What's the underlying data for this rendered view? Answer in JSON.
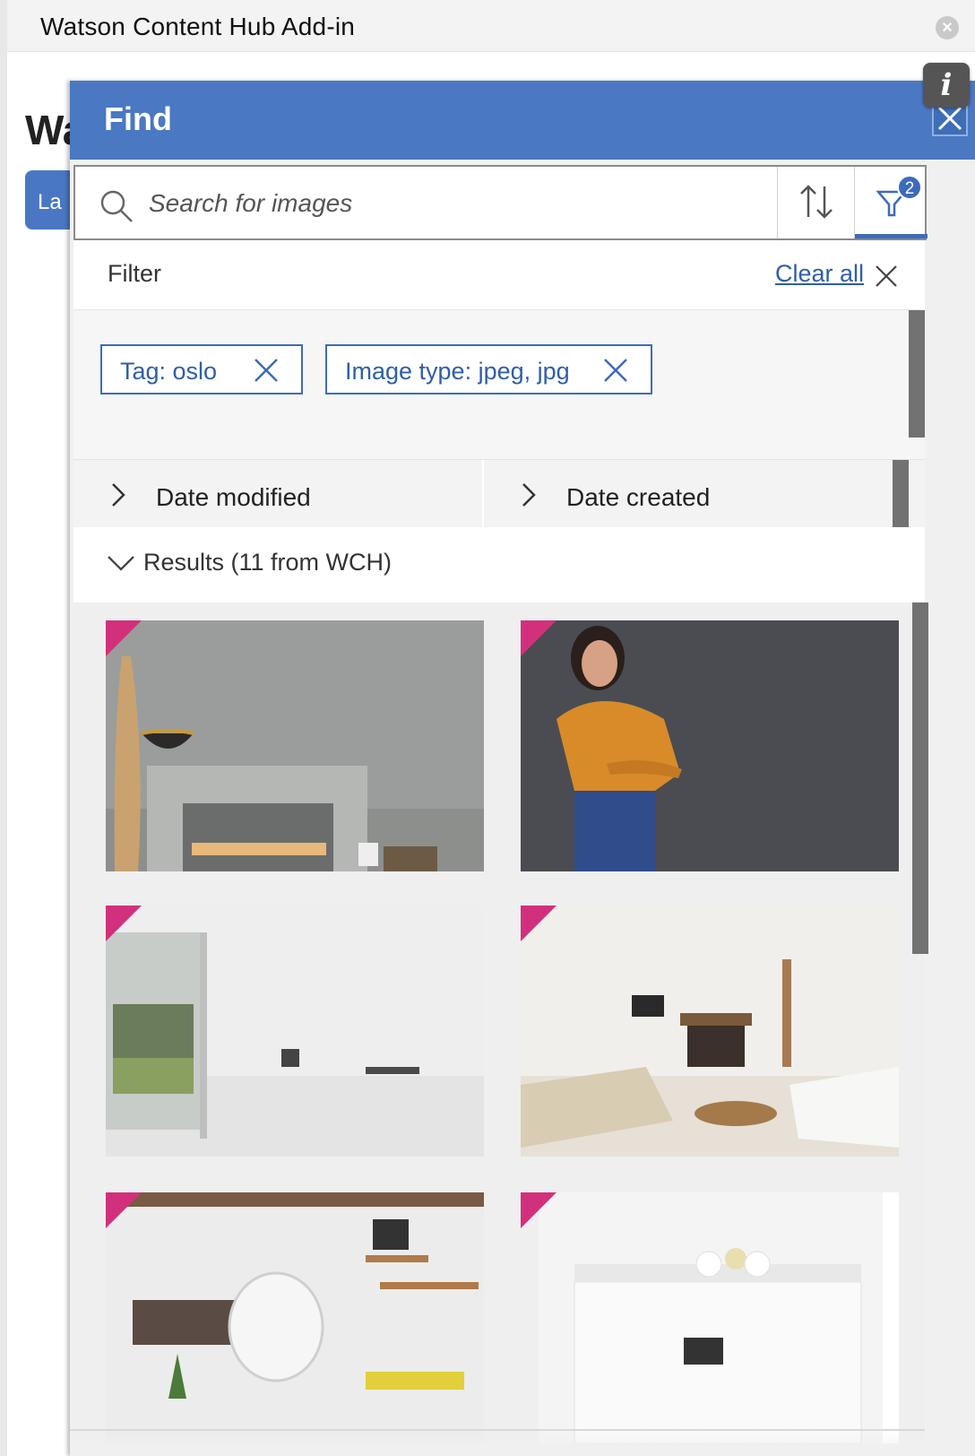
{
  "window": {
    "title": "Watson Content Hub Add-in",
    "background_heading": "Wa",
    "background_button_label": "La"
  },
  "panel": {
    "title": "Find",
    "info_label": "i",
    "accent_color": "#4a78c2"
  },
  "search": {
    "placeholder": "Search for images",
    "value": ""
  },
  "filter": {
    "label": "Filter",
    "clear_all_label": "Clear all",
    "active_count": "2",
    "chips": [
      {
        "label": "Tag: oslo"
      },
      {
        "label": "Image type: jpeg, jpg"
      }
    ]
  },
  "date_filters": [
    {
      "label": "Date modified"
    },
    {
      "label": "Date created"
    }
  ],
  "results": {
    "label": "Results (11 from WCH)"
  },
  "images": [
    {
      "subject": "fireplace-interior"
    },
    {
      "subject": "woman-portrait"
    },
    {
      "subject": "white-room-window"
    },
    {
      "subject": "living-room-fireplace"
    },
    {
      "subject": "hanging-chair-room"
    },
    {
      "subject": "white-kitchen"
    }
  ],
  "colors": {
    "corner_badge": "#d2307c",
    "link": "#2f5ea8",
    "chip_border": "#3d6bbb"
  }
}
